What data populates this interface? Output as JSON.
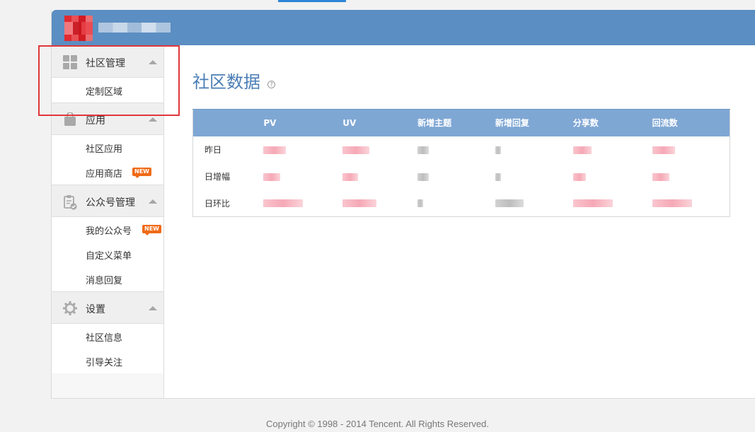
{
  "sidebar": {
    "groups": [
      {
        "label": "社区管理",
        "icon": "grid-icon",
        "items": [
          {
            "label": "定制区域"
          }
        ]
      },
      {
        "label": "应用",
        "icon": "shopping-bag-icon",
        "items": [
          {
            "label": "社区应用"
          },
          {
            "label": "应用商店",
            "badge": "NEW"
          }
        ]
      },
      {
        "label": "公众号管理",
        "icon": "clipboard-check-icon",
        "items": [
          {
            "label": "我的公众号",
            "badge": "NEW"
          },
          {
            "label": "自定义菜单"
          },
          {
            "label": "消息回复"
          }
        ]
      },
      {
        "label": "设置",
        "icon": "gear-icon",
        "items": [
          {
            "label": "社区信息"
          },
          {
            "label": "引导关注"
          }
        ]
      }
    ]
  },
  "main": {
    "title": "社区数据",
    "help_glyph": "?",
    "table": {
      "headers": [
        "",
        "PV",
        "UV",
        "新增主题",
        "新增回复",
        "分享数",
        "回流数"
      ],
      "rows": [
        {
          "label": "昨日"
        },
        {
          "label": "日增幅"
        },
        {
          "label": "日环比"
        }
      ]
    }
  },
  "footer": {
    "text": "Copyright © 1998 - 2014 Tencent. All Rights Reserved."
  },
  "colors": {
    "header": "#5b8ec2",
    "table_header": "#7fa7d4",
    "title": "#4a7db5",
    "highlight": "#e0373a",
    "badge": "#f06a16"
  }
}
